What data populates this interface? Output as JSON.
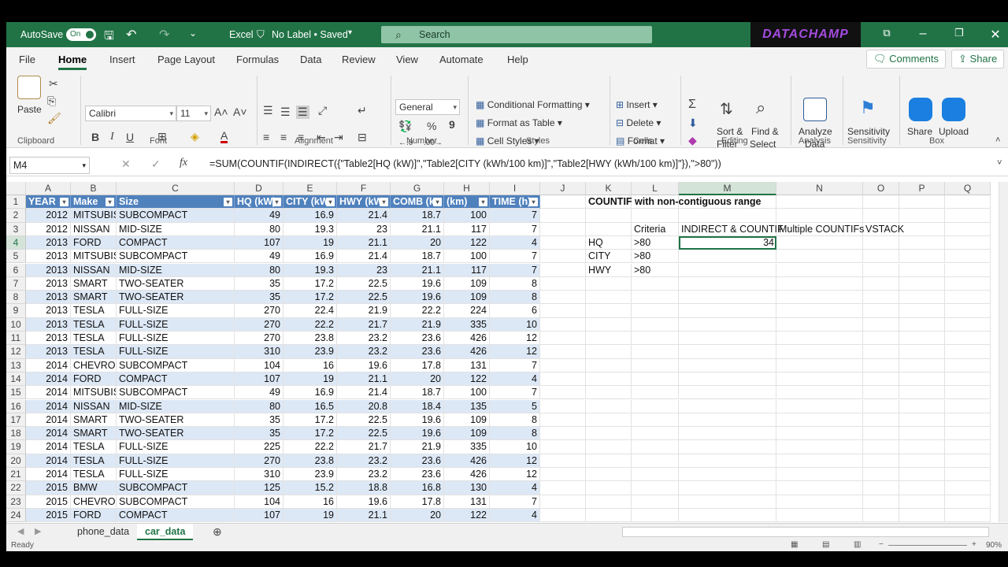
{
  "titlebar": {
    "autosave_label": "AutoSave",
    "autosave_state": "On",
    "app": "Excel",
    "label_status": "No Label • Saved",
    "search_placeholder": "Search",
    "brand": "DATACHAMP"
  },
  "menu": {
    "items": [
      "File",
      "Home",
      "Insert",
      "Page Layout",
      "Formulas",
      "Data",
      "Review",
      "View",
      "Automate",
      "Help"
    ],
    "active": "Home",
    "comments": "Comments",
    "share": "Share"
  },
  "ribbon": {
    "clipboard": {
      "paste": "Paste",
      "label": "Clipboard"
    },
    "font": {
      "family": "Calibri",
      "size": "11",
      "label": "Font",
      "bold": "B",
      "italic": "I",
      "underline": "U"
    },
    "alignment": {
      "label": "Alignment"
    },
    "number": {
      "format": "General",
      "label": "Number"
    },
    "styles": {
      "conditional": "Conditional Formatting",
      "table": "Format as Table",
      "cell": "Cell Styles",
      "label": "Styles"
    },
    "cells": {
      "insert": "Insert",
      "delete": "Delete",
      "format": "Format",
      "label": "Cells"
    },
    "editing": {
      "sort1": "Sort &",
      "sort2": "Filter",
      "find1": "Find &",
      "find2": "Select",
      "label": "Editing"
    },
    "analysis": {
      "b1": "Analyze",
      "b2": "Data",
      "label": "Analysis"
    },
    "sensitivity": {
      "b": "Sensitivity",
      "label": "Sensitivity"
    },
    "box": {
      "share": "Share",
      "upload": "Upload",
      "label": "Box"
    }
  },
  "formula_bar": {
    "name_box": "M4",
    "fx": "fx",
    "formula": "=SUM(COUNTIF(INDIRECT({\"Table2[HQ (kW)]\",\"Table2[CITY (kWh/100 km)]\",\"Table2[HWY (kWh/100 km)]\"}),\">80\"))"
  },
  "columns": [
    "A",
    "B",
    "C",
    "D",
    "E",
    "F",
    "G",
    "H",
    "I",
    "J",
    "K",
    "L",
    "M",
    "N",
    "O",
    "P",
    "Q"
  ],
  "table_headers": [
    "YEAR",
    "Make",
    "Size",
    "HQ (kW)",
    "CITY (kW",
    "HWY (kW",
    "COMB (k",
    "(km)",
    "TIME (h)"
  ],
  "rows": [
    [
      "2012",
      "MITSUBISHI",
      "SUBCOMPACT",
      "49",
      "16.9",
      "21.4",
      "18.7",
      "100",
      "7"
    ],
    [
      "2012",
      "NISSAN",
      "MID-SIZE",
      "80",
      "19.3",
      "23",
      "21.1",
      "117",
      "7"
    ],
    [
      "2013",
      "FORD",
      "COMPACT",
      "107",
      "19",
      "21.1",
      "20",
      "122",
      "4"
    ],
    [
      "2013",
      "MITSUBISHI",
      "SUBCOMPACT",
      "49",
      "16.9",
      "21.4",
      "18.7",
      "100",
      "7"
    ],
    [
      "2013",
      "NISSAN",
      "MID-SIZE",
      "80",
      "19.3",
      "23",
      "21.1",
      "117",
      "7"
    ],
    [
      "2013",
      "SMART",
      "TWO-SEATER",
      "35",
      "17.2",
      "22.5",
      "19.6",
      "109",
      "8"
    ],
    [
      "2013",
      "SMART",
      "TWO-SEATER",
      "35",
      "17.2",
      "22.5",
      "19.6",
      "109",
      "8"
    ],
    [
      "2013",
      "TESLA",
      "FULL-SIZE",
      "270",
      "22.4",
      "21.9",
      "22.2",
      "224",
      "6"
    ],
    [
      "2013",
      "TESLA",
      "FULL-SIZE",
      "270",
      "22.2",
      "21.7",
      "21.9",
      "335",
      "10"
    ],
    [
      "2013",
      "TESLA",
      "FULL-SIZE",
      "270",
      "23.8",
      "23.2",
      "23.6",
      "426",
      "12"
    ],
    [
      "2013",
      "TESLA",
      "FULL-SIZE",
      "310",
      "23.9",
      "23.2",
      "23.6",
      "426",
      "12"
    ],
    [
      "2014",
      "CHEVROLET",
      "SUBCOMPACT",
      "104",
      "16",
      "19.6",
      "17.8",
      "131",
      "7"
    ],
    [
      "2014",
      "FORD",
      "COMPACT",
      "107",
      "19",
      "21.1",
      "20",
      "122",
      "4"
    ],
    [
      "2014",
      "MITSUBISHI",
      "SUBCOMPACT",
      "49",
      "16.9",
      "21.4",
      "18.7",
      "100",
      "7"
    ],
    [
      "2014",
      "NISSAN",
      "MID-SIZE",
      "80",
      "16.5",
      "20.8",
      "18.4",
      "135",
      "5"
    ],
    [
      "2014",
      "SMART",
      "TWO-SEATER",
      "35",
      "17.2",
      "22.5",
      "19.6",
      "109",
      "8"
    ],
    [
      "2014",
      "SMART",
      "TWO-SEATER",
      "35",
      "17.2",
      "22.5",
      "19.6",
      "109",
      "8"
    ],
    [
      "2014",
      "TESLA",
      "FULL-SIZE",
      "225",
      "22.2",
      "21.7",
      "21.9",
      "335",
      "10"
    ],
    [
      "2014",
      "TESLA",
      "FULL-SIZE",
      "270",
      "23.8",
      "23.2",
      "23.6",
      "426",
      "12"
    ],
    [
      "2014",
      "TESLA",
      "FULL-SIZE",
      "310",
      "23.9",
      "23.2",
      "23.6",
      "426",
      "12"
    ],
    [
      "2015",
      "BMW",
      "SUBCOMPACT",
      "125",
      "15.2",
      "18.8",
      "16.8",
      "130",
      "4"
    ],
    [
      "2015",
      "CHEVROLET",
      "SUBCOMPACT",
      "104",
      "16",
      "19.6",
      "17.8",
      "131",
      "7"
    ],
    [
      "2015",
      "FORD",
      "COMPACT",
      "107",
      "19",
      "21.1",
      "20",
      "122",
      "4"
    ]
  ],
  "side": {
    "title": "COUNTIF with non-contiguous range",
    "criteria_header": "Criteria",
    "h_m": "INDIRECT & COUNTIF",
    "h_n": "Multiple COUNTIFs",
    "h_o": "VSTACK",
    "labels": [
      "HQ",
      "CITY",
      "HWY"
    ],
    "criteria": [
      ">80",
      ">80",
      ">80"
    ],
    "result": "34"
  },
  "sheets": [
    "phone_data",
    "car_data"
  ],
  "active_sheet": "car_data",
  "status": {
    "ready": "Ready",
    "zoom": "90%"
  }
}
